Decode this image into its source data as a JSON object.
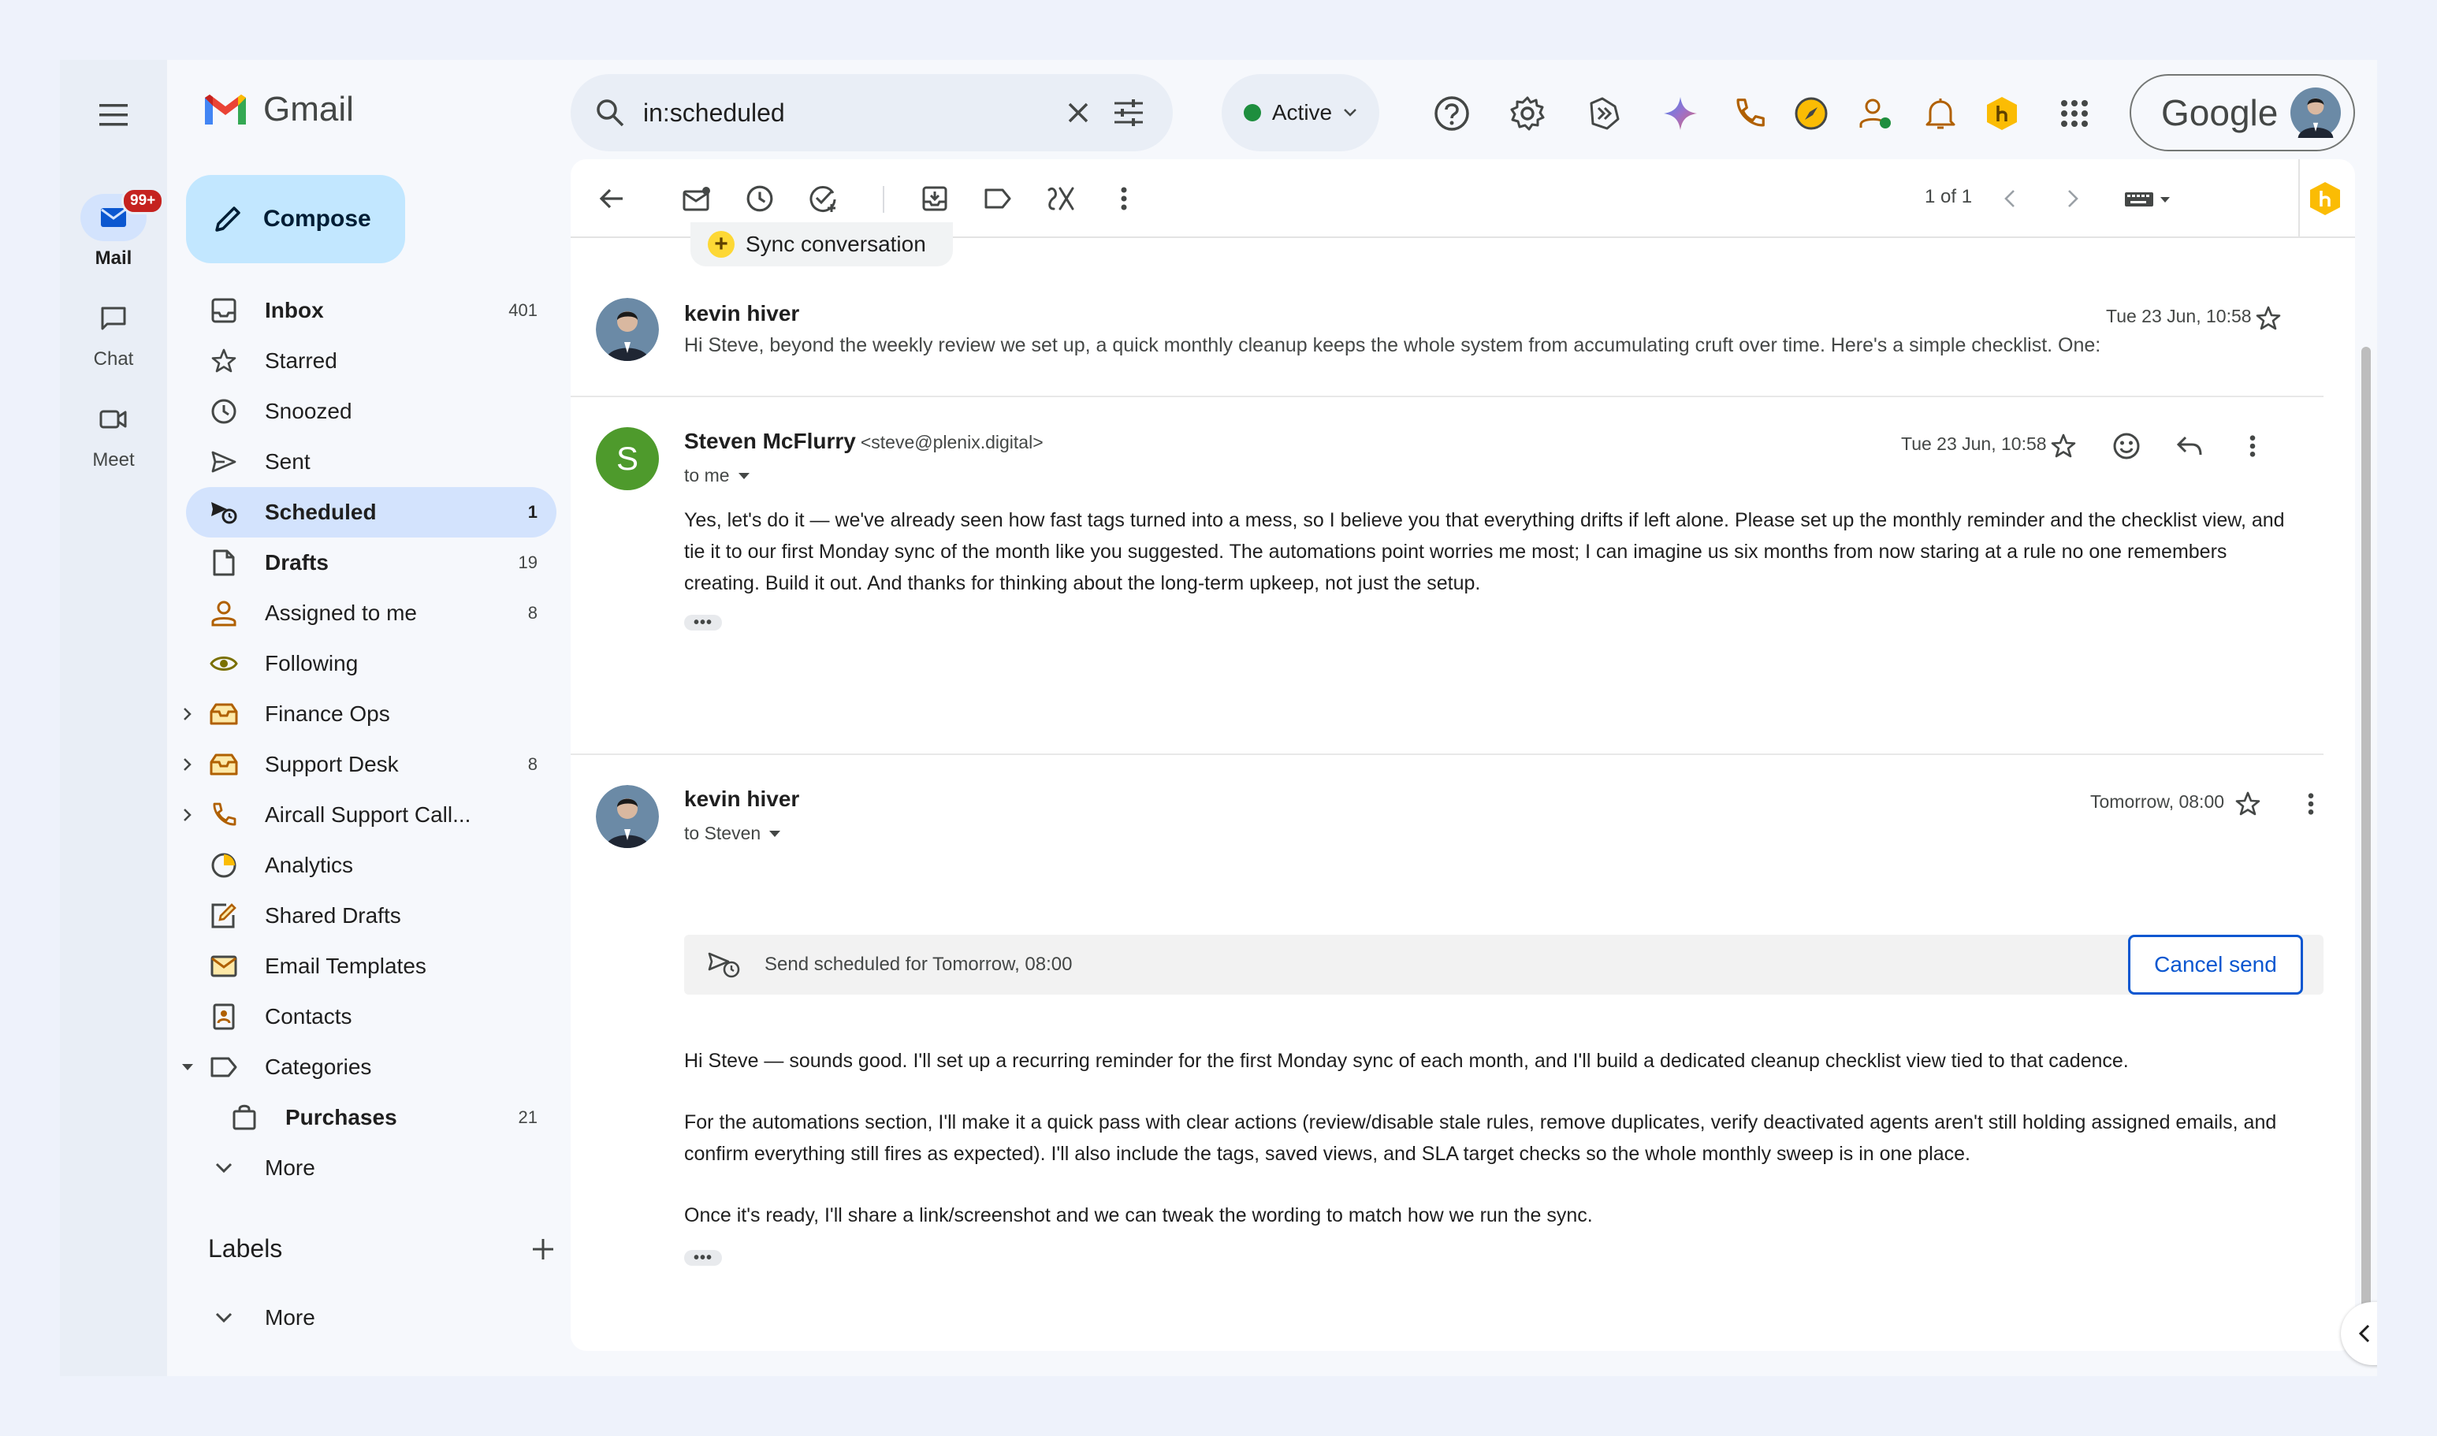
{
  "rail": {
    "items": [
      {
        "label": "Mail",
        "badge": "99+"
      },
      {
        "label": "Chat"
      },
      {
        "label": "Meet"
      }
    ]
  },
  "app": {
    "name": "Gmail"
  },
  "compose": {
    "label": "Compose"
  },
  "nav": {
    "items": [
      {
        "label": "Inbox",
        "count": "401"
      },
      {
        "label": "Starred",
        "count": ""
      },
      {
        "label": "Snoozed",
        "count": ""
      },
      {
        "label": "Sent",
        "count": ""
      },
      {
        "label": "Scheduled",
        "count": "1"
      },
      {
        "label": "Drafts",
        "count": "19"
      },
      {
        "label": "Assigned to me",
        "count": "8"
      },
      {
        "label": "Following",
        "count": ""
      },
      {
        "label": "Finance Ops",
        "count": ""
      },
      {
        "label": "Support Desk",
        "count": "8"
      },
      {
        "label": "Aircall Support Call...",
        "count": ""
      },
      {
        "label": "Analytics",
        "count": ""
      },
      {
        "label": "Shared Drafts",
        "count": ""
      },
      {
        "label": "Email Templates",
        "count": ""
      },
      {
        "label": "Contacts",
        "count": ""
      },
      {
        "label": "Categories",
        "count": ""
      },
      {
        "label": "Purchases",
        "count": "21"
      },
      {
        "label": "More",
        "count": ""
      }
    ]
  },
  "labels": {
    "title": "Labels",
    "more": "More"
  },
  "search": {
    "value": "in:scheduled"
  },
  "status": {
    "label": "Active",
    "color": "#1e8e3e"
  },
  "account": {
    "brand": "Google"
  },
  "toolbar": {
    "pager": "1 of 1"
  },
  "sync": {
    "label": "Sync conversation"
  },
  "thread": {
    "collapsed": {
      "sender": "kevin hiver",
      "date": "Tue 23 Jun, 10:58",
      "snippet": "Hi Steve, beyond the weekly review we set up, a quick monthly cleanup keeps the whole system from accumulating cruft over time. Here's a simple checklist. One:"
    },
    "message1": {
      "avatar_letter": "S",
      "sender": "Steven McFlurry",
      "email": "<steve@plenix.digital>",
      "to": "to me",
      "date": "Tue 23 Jun, 10:58",
      "body": "Yes, let's do it — we've already seen how fast tags turned into a mess, so I believe you that everything drifts if left alone. Please set up the monthly reminder and the checklist view, and tie it to our first Monday sync of the month like you suggested. The automations point worries me most; I can imagine us six months from now staring at a rule no one remembers creating. Build it out. And thanks for thinking about the long-term upkeep, not just the setup."
    },
    "message2": {
      "sender": "kevin hiver",
      "to": "to Steven",
      "date": "Tomorrow, 08:00",
      "scheduled_text": "Send scheduled for Tomorrow, 08:00",
      "cancel_label": "Cancel send",
      "p1": "Hi Steve — sounds good. I'll set up a recurring reminder for the first Monday sync of each month, and I'll build a dedicated cleanup checklist view tied to that cadence.",
      "p2": "For the automations section, I'll make it a quick pass with clear actions (review/disable stale rules, remove duplicates, verify deactivated agents aren't still holding assigned emails, and confirm everything still fires as expected). I'll also include the tags, saved views, and SLA target checks so the whole monthly sweep is in one place.",
      "p3": "Once it's ready, I'll share a link/screenshot and we can tweak the wording to match how we run the sync."
    }
  }
}
